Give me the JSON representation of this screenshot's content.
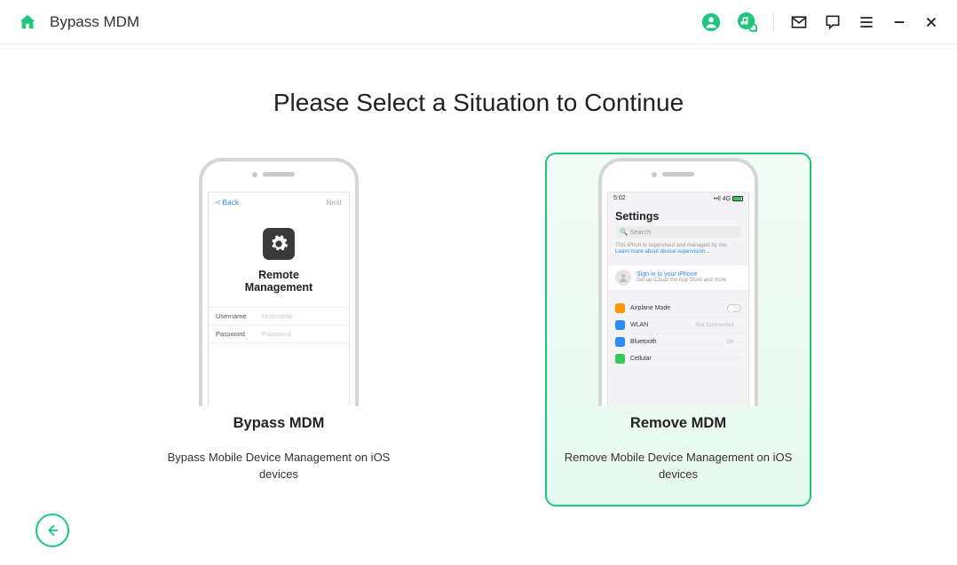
{
  "title": "Bypass MDM",
  "heading": "Please Select a Situation to Continue",
  "colors": {
    "accent": "#1ec77b"
  },
  "options": [
    {
      "title": "Bypass MDM",
      "desc": "Bypass Mobile Device Management on iOS devices",
      "selected": false,
      "phone": {
        "back": "Back",
        "next": "Next",
        "screen_title": "Remote\nManagement",
        "rows": [
          {
            "label": "Username",
            "placeholder": "Username"
          },
          {
            "label": "Password",
            "placeholder": "Password"
          }
        ]
      }
    },
    {
      "title": "Remove MDM",
      "desc": "Remove Mobile Device Management on iOS devices",
      "selected": true,
      "phone": {
        "time": "5:02",
        "signal": "••ll 4G",
        "screen_title": "Settings",
        "search_placeholder": "Search",
        "supervision_note": "This iPhon is supervised and managed by xxx.",
        "supervision_link": "Learn more about device supervision...",
        "signin": "Sign in to your iPhone",
        "signin_sub": "Set up iCloud the App Store and more",
        "items": [
          {
            "label": "Airplane Mode",
            "color": "#ff9500",
            "toggle": true
          },
          {
            "label": "WLAN",
            "color": "#2a8df5",
            "value": "Not Connected"
          },
          {
            "label": "Bluetooth",
            "color": "#2a8df5",
            "value": "On"
          },
          {
            "label": "Cellular",
            "color": "#34c759",
            "value": ""
          }
        ]
      }
    }
  ]
}
